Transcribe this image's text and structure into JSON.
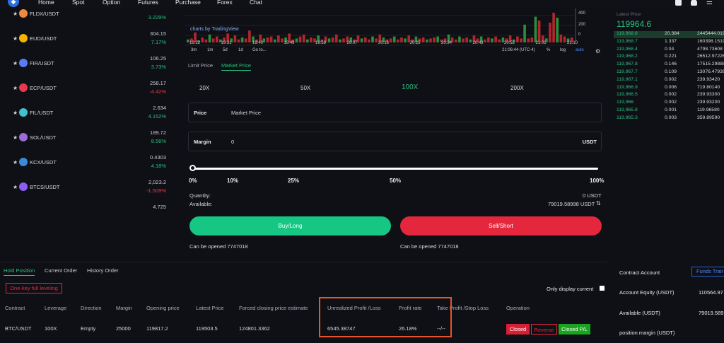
{
  "nav": {
    "items": [
      "Home",
      "Spot",
      "Option",
      "Futures",
      "Purchase",
      "Forex",
      "Chat"
    ]
  },
  "markets": [
    {
      "pair": "FLDX/USDT",
      "price": "",
      "change": "3.229%",
      "dir": "up",
      "coin_color": "#f0883e"
    },
    {
      "pair": "EUD/USDT",
      "price": "304.15",
      "change": "7.17%",
      "dir": "up",
      "coin_color": "#f4b400"
    },
    {
      "pair": "FIR/USDT",
      "price": "106.25",
      "change": "3.73%",
      "dir": "up",
      "coin_color": "#5b7cf0"
    },
    {
      "pair": "ECP/USDT",
      "price": "258.17",
      "change": "-4.42%",
      "dir": "down",
      "coin_color": "#e8384f"
    },
    {
      "pair": "FIL/USDT",
      "price": "2.634",
      "change": "4.152%",
      "dir": "up",
      "coin_color": "#42c1ca"
    },
    {
      "pair": "SOL/USDT",
      "price": "189.72",
      "change": "8.56%",
      "dir": "up",
      "coin_color": "#9a6dd8"
    },
    {
      "pair": "KCX/USDT",
      "price": "0.4303",
      "change": "4.18%",
      "dir": "up",
      "coin_color": "#3a8bd8"
    },
    {
      "pair": "BTCS/USDT",
      "price": "2,023.2",
      "change": "-1.509%",
      "dir": "down",
      "coin_color": "#8d5cf0"
    },
    {
      "pair": "",
      "price": "4.725",
      "change": "",
      "dir": "up",
      "coin_color": "#0f1015"
    }
  ],
  "chart": {
    "tv_label": "charts by TradingView",
    "times": [
      "19:22",
      "19:31",
      "19:40",
      "19:49",
      "19:58",
      "20:07",
      "20:16",
      "20:25",
      "20:34",
      "20:43",
      "20:52",
      "21:01",
      "21:10"
    ],
    "intervals": [
      "3m",
      "1m",
      "5d",
      "1d",
      "Go to..."
    ],
    "clock": "21:06:44 (UTC-4)",
    "opts": [
      "%",
      "log",
      "auto"
    ],
    "axis": [
      "400",
      "200",
      "0"
    ],
    "volumes": [
      3,
      4,
      10,
      2,
      5,
      3,
      8,
      4,
      6,
      3,
      5,
      9,
      4,
      7,
      3,
      5,
      4,
      12,
      6,
      3,
      8,
      4,
      5,
      6,
      3,
      7,
      4,
      5,
      9,
      3,
      4,
      6,
      8,
      3,
      5,
      4,
      7,
      3,
      6,
      4,
      5,
      8,
      3,
      4,
      6,
      5,
      3,
      7,
      4,
      5,
      3,
      6,
      4,
      8,
      5,
      3,
      4,
      6,
      3,
      5,
      4,
      7,
      3,
      6,
      4,
      5,
      3,
      4,
      5,
      6,
      3,
      4,
      8,
      5,
      3,
      6,
      4,
      5,
      3,
      7,
      4,
      6,
      3,
      5,
      4,
      6,
      3,
      5,
      4,
      7,
      3,
      6,
      4,
      18,
      4,
      5,
      26,
      22,
      7,
      4,
      20,
      30,
      25,
      8,
      6,
      4,
      5
    ]
  },
  "order": {
    "tabs": [
      "Limit Price",
      "Market Price"
    ],
    "leverages": [
      "20X",
      "50X",
      "100X",
      "200X"
    ],
    "price_label": "Price",
    "price_value": "Market Price",
    "margin_label": "Margin",
    "margin_value": "0",
    "margin_unit": "USDT",
    "pcts": [
      "0%",
      "10%",
      "25%",
      "50%",
      "100%"
    ],
    "quantity_label": "Quantity:",
    "quantity_value": "0 USDT",
    "available_label": "Available:",
    "available_value": "79019.58998 USDT",
    "buy_label": "Buy/Long",
    "sell_label": "Sell/Short",
    "can_open_left": "Can be opened 7747018",
    "can_open_right": "Can be opened 7747018"
  },
  "orderbook": {
    "header": "Latest Price",
    "latest": "119964.6",
    "rows": [
      {
        "price": "119,968.8",
        "qty": "20.384",
        "total": "2445444.019"
      },
      {
        "price": "119,968.7",
        "qty": "1.337",
        "total": "160398.1519"
      },
      {
        "price": "119,968.4",
        "qty": "0.04",
        "total": "4798.73608"
      },
      {
        "price": "119,968.2",
        "qty": "0.221",
        "total": "26512.97226"
      },
      {
        "price": "119,967.8",
        "qty": "0.146",
        "total": "17515.29888"
      },
      {
        "price": "119,967.7",
        "qty": "0.109",
        "total": "13076.47939"
      },
      {
        "price": "119,967.1",
        "qty": "0.002",
        "total": "239.93420"
      },
      {
        "price": "119,966.9",
        "qty": "0.006",
        "total": "719.80140"
      },
      {
        "price": "119,966.5",
        "qty": "0.002",
        "total": "239.93300"
      },
      {
        "price": "119,966",
        "qty": "0.002",
        "total": "239.93200"
      },
      {
        "price": "119,965.8",
        "qty": "0.001",
        "total": "119.96580"
      },
      {
        "price": "119,965.3",
        "qty": "0.003",
        "total": "359.89590"
      }
    ]
  },
  "positions": {
    "tabs": [
      "Hold Position",
      "Current Order",
      "History Order"
    ],
    "one_key": "One-key full leveling",
    "only_display": "Only display current",
    "headers": [
      "Contract",
      "Leverage",
      "Direction",
      "Margin",
      "Opening price",
      "Latest Price",
      "Forced closing price estimate",
      "Unrealized Profit /Loss",
      "Profit rate",
      "Take Profit /Stop Loss",
      "Operation"
    ],
    "row": {
      "contract": "BTC/USDT",
      "leverage": "100X",
      "direction": "Empty",
      "margin": "25000",
      "opening": "119817.2",
      "latest": "119503.5",
      "forced": "124801.3362",
      "pnl": "6545.38747",
      "rate": "26.18%",
      "tpsl": "--/--"
    },
    "ops": [
      "Closed",
      "Reverse",
      "Closed P/L"
    ]
  },
  "account": {
    "title": "Contract Account",
    "funds_btn": "Funds Tran",
    "equity_label": "Account Equity (USDT)",
    "equity_value": "110564.97",
    "available_label": "Available (USDT)",
    "available_value": "79019.589",
    "position_margin_label": "position margin (USDT)"
  }
}
